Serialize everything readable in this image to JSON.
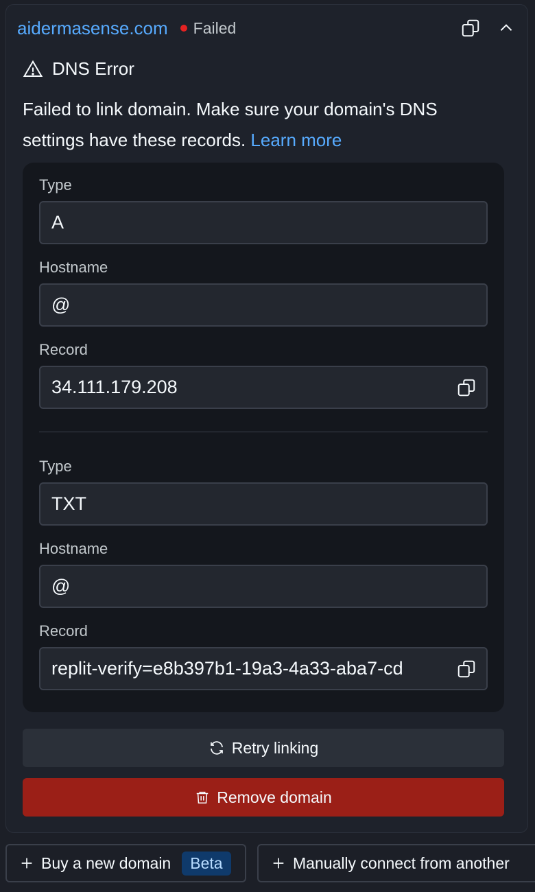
{
  "header": {
    "domain": "aidermasense.com",
    "status": "Failed",
    "colors": {
      "status_dot": "#e52222",
      "link": "#57abff"
    },
    "icons": [
      "copy-icon",
      "chevron-up-icon"
    ]
  },
  "error": {
    "title": "DNS Error",
    "message": "Failed to link domain. Make sure your domain's DNS settings have these records.",
    "learn_more": "Learn more"
  },
  "records": [
    {
      "type_label": "Type",
      "type": "A",
      "hostname_label": "Hostname",
      "hostname": "@",
      "record_label": "Record",
      "record": "34.111.179.208"
    },
    {
      "type_label": "Type",
      "type": "TXT",
      "hostname_label": "Hostname",
      "hostname": "@",
      "record_label": "Record",
      "record": "replit-verify=e8b397b1-19a3-4a33-aba7-cd"
    }
  ],
  "actions": {
    "retry": "Retry linking",
    "remove": "Remove domain",
    "remove_color": "#9b1f17"
  },
  "footer": {
    "buy": "Buy a new domain",
    "buy_badge": "Beta",
    "manual": "Manually connect from another"
  }
}
